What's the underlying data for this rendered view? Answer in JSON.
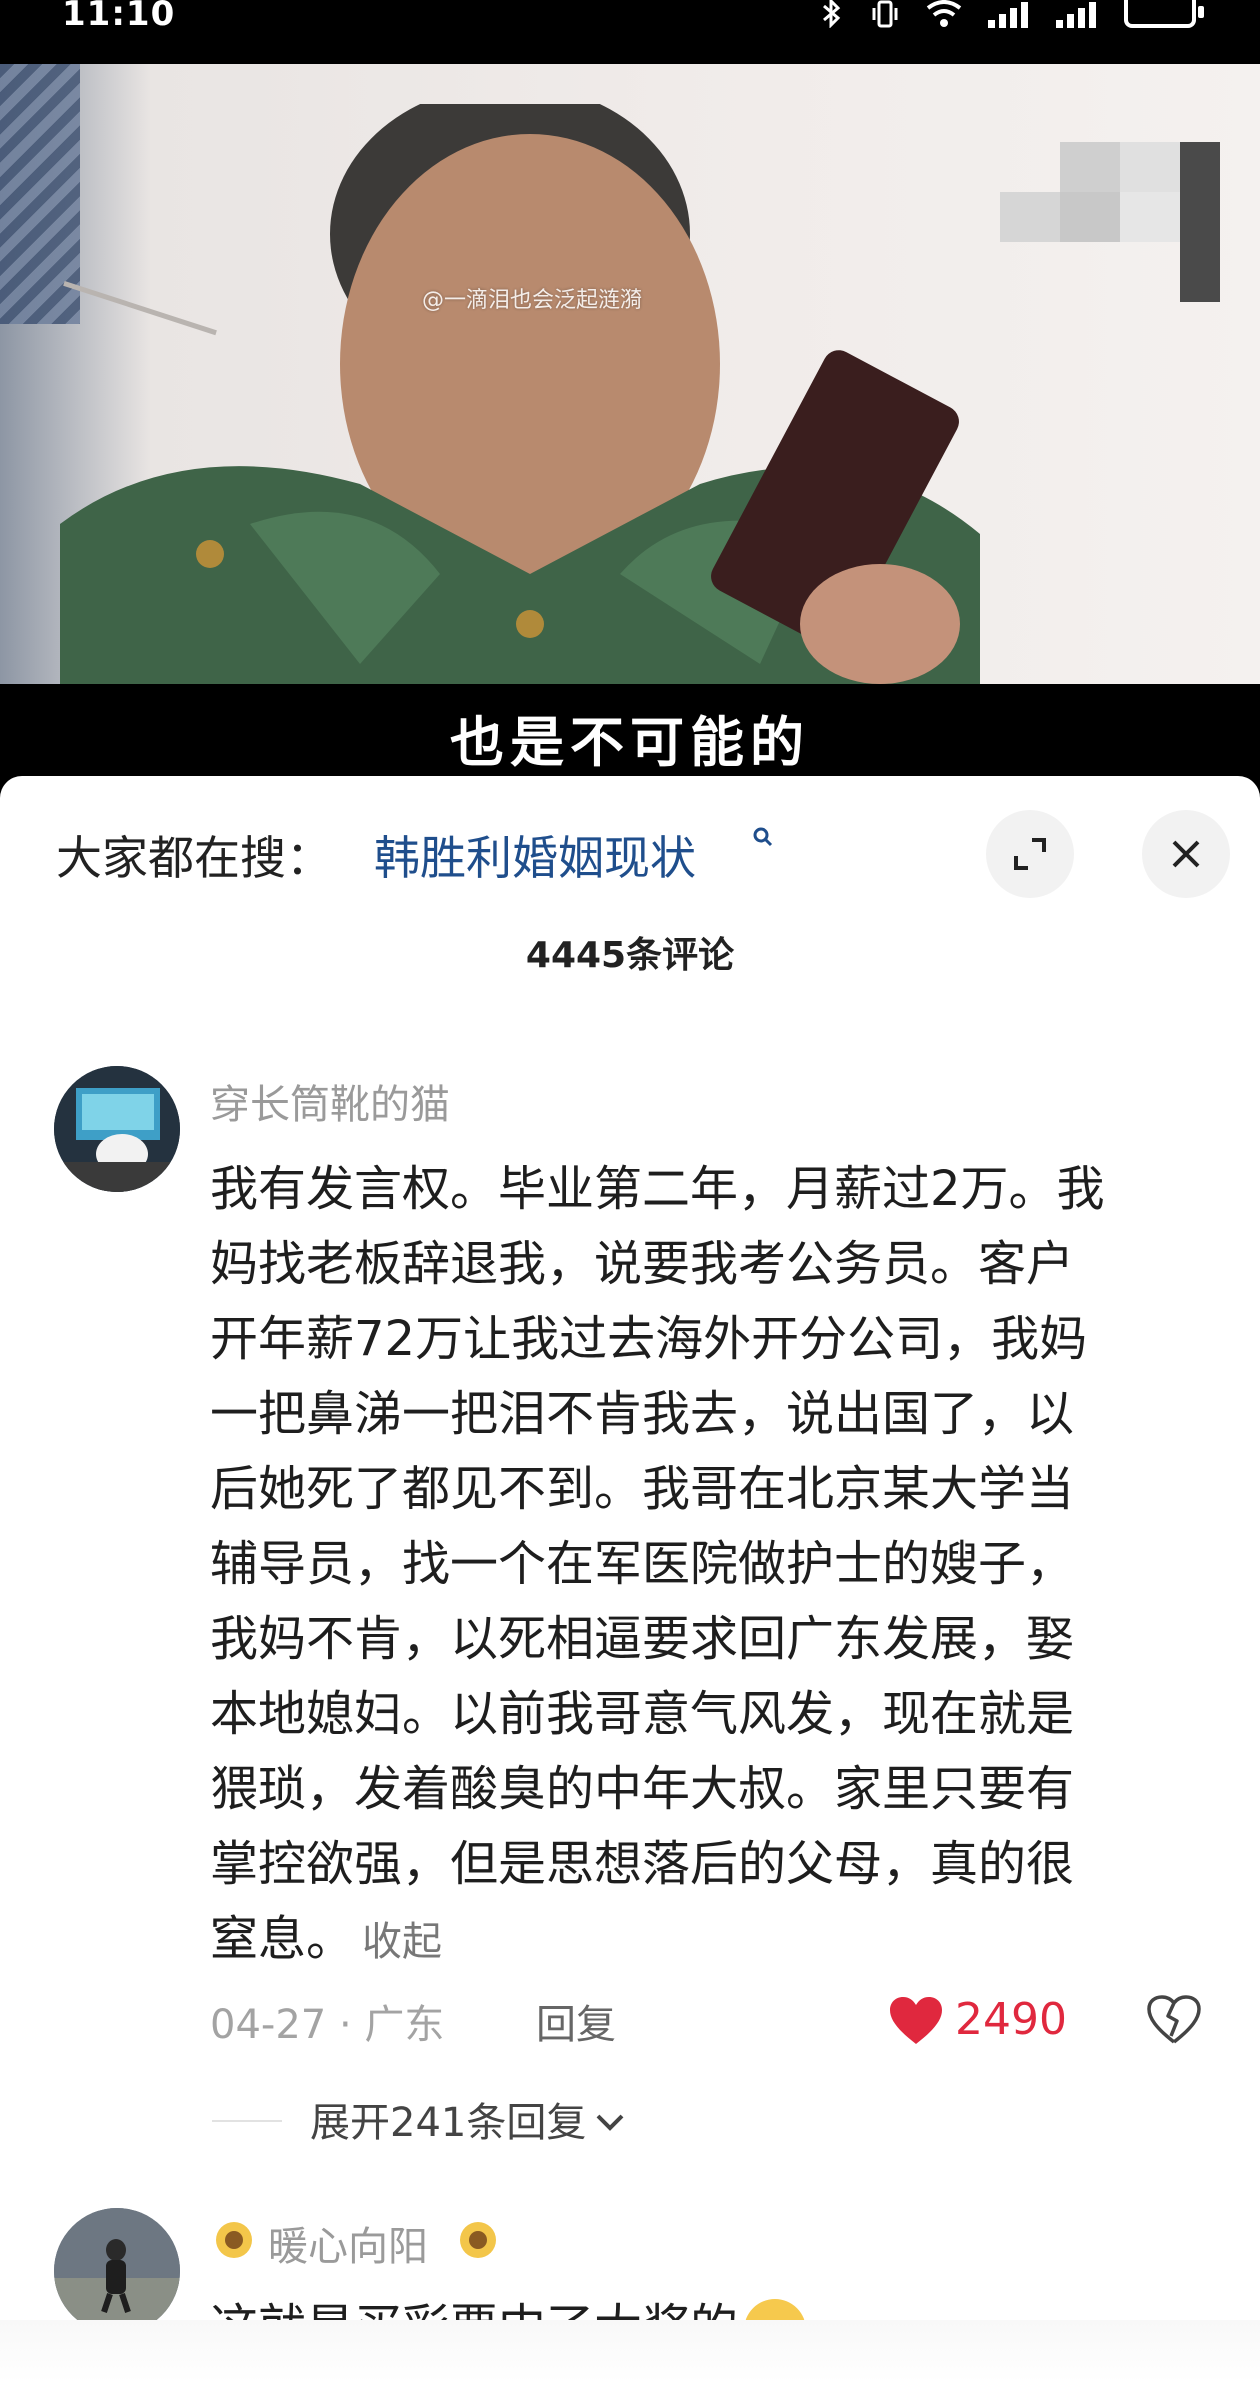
{
  "status_bar": {
    "time": "11:10"
  },
  "video": {
    "watermark": "@一滴泪也会泛起涟漪",
    "subtitle": "也是不可能的"
  },
  "comments_panel": {
    "search_prefix": "大家都在搜：",
    "search_term": "韩胜利婚姻现状",
    "comment_count": "4445条评论",
    "comments": [
      {
        "username": "穿长筒靴的猫",
        "lines": [
          "我有发言权。毕业第二年，月薪过2万。我",
          "妈找老板辞退我，说要我考公务员。客户",
          "开年薪72万让我过去海外开分公司，我妈",
          "一把鼻涕一把泪不肯我去，说出国了，以",
          "后她死了都见不到。我哥在北京某大学当",
          "辅导员，找一个在军医院做护士的嫂子，",
          "我妈不肯，以死相逼要求回广东发展，娶",
          "本地媳妇。以前我哥意气风发，现在就是",
          "猥琐，发着酸臭的中年大叔。家里只要有",
          "掌控欲强，但是思想落后的父母，真的很",
          "窒息。"
        ],
        "collapse_label": "收起",
        "date_location": "04-27 · 广东",
        "reply_label": "回复",
        "likes": "2490",
        "expand_replies": "展开241条回复"
      },
      {
        "username": "暖心向阳",
        "preview_text": "这就是买彩票中了大奖的"
      }
    ]
  },
  "colors": {
    "accent_like": "#e0283e",
    "link": "#1f4e8c"
  }
}
